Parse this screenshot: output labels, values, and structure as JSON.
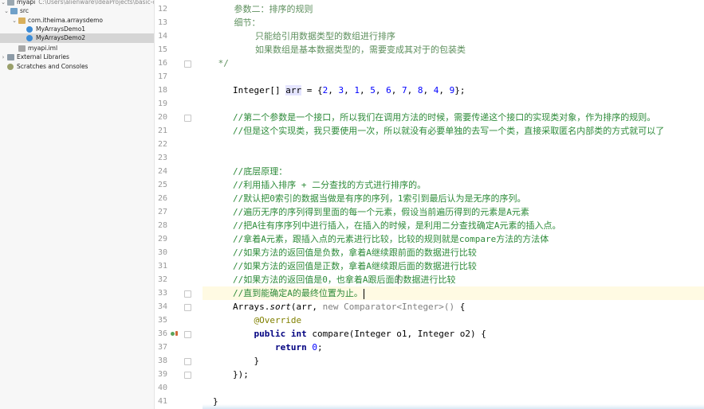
{
  "project_tree": {
    "items": [
      {
        "label": "myapi",
        "path": "C:\\Users\\alienware\\IdeaProjects\\basic-code\\m",
        "arrow": "v",
        "icon": "folder"
      },
      {
        "label": "src",
        "path": "",
        "arrow": "v",
        "icon": "src-folder"
      },
      {
        "label": "com.itheima.arraysdemo",
        "path": "",
        "arrow": "v",
        "icon": "package"
      },
      {
        "label": "MyArraysDemo1",
        "path": "",
        "arrow": "",
        "icon": "class"
      },
      {
        "label": "MyArraysDemo2",
        "path": "",
        "arrow": "",
        "icon": "class"
      },
      {
        "label": "myapi.iml",
        "path": "",
        "arrow": "",
        "icon": "iml-file"
      },
      {
        "label": "External Libraries",
        "path": "",
        "arrow": ">",
        "icon": "library"
      },
      {
        "label": "Scratches and Consoles",
        "path": "",
        "arrow": "",
        "icon": "scratch"
      }
    ],
    "selected": "MyArraysDemo2"
  },
  "editor": {
    "current_line": 33,
    "lines": [
      {
        "n": "12",
        "t": [
          {
            "c": "doc",
            "s": "    参数二：排序的规则"
          }
        ]
      },
      {
        "n": "13",
        "t": [
          {
            "c": "doc",
            "s": "    细节："
          }
        ]
      },
      {
        "n": "14",
        "t": [
          {
            "c": "doc",
            "s": "        只能给引用数据类型的数组进行排序"
          }
        ]
      },
      {
        "n": "15",
        "t": [
          {
            "c": "doc",
            "s": "        如果数组是基本数据类型的，需要变成其对于的包装类"
          }
        ]
      },
      {
        "n": "16",
        "t": [
          {
            "c": "doc",
            "s": " */"
          }
        ]
      },
      {
        "n": "17",
        "t": []
      },
      {
        "n": "18",
        "t": [
          {
            "c": "",
            "s": "Integer[] "
          },
          {
            "c": "hl",
            "s": "arr"
          },
          {
            "c": "",
            "s": " = {"
          },
          {
            "c": "num",
            "s": "2"
          },
          {
            "c": "",
            "s": ", "
          },
          {
            "c": "num",
            "s": "3"
          },
          {
            "c": "",
            "s": ", "
          },
          {
            "c": "num",
            "s": "1"
          },
          {
            "c": "",
            "s": ", "
          },
          {
            "c": "num",
            "s": "5"
          },
          {
            "c": "",
            "s": ", "
          },
          {
            "c": "num",
            "s": "6"
          },
          {
            "c": "",
            "s": ", "
          },
          {
            "c": "num",
            "s": "7"
          },
          {
            "c": "",
            "s": ", "
          },
          {
            "c": "num",
            "s": "8"
          },
          {
            "c": "",
            "s": ", "
          },
          {
            "c": "num",
            "s": "4"
          },
          {
            "c": "",
            "s": ", "
          },
          {
            "c": "num",
            "s": "9"
          },
          {
            "c": "",
            "s": "};"
          }
        ]
      },
      {
        "n": "19",
        "t": []
      },
      {
        "n": "20",
        "t": [
          {
            "c": "cm",
            "s": "//第二个参数是一个接口，所以我们在调用方法的时候，需要传递这个接口的实现类对象，作为排序的规则。"
          }
        ]
      },
      {
        "n": "21",
        "t": [
          {
            "c": "cm",
            "s": "//但是这个实现类，我只要使用一次，所以就没有必要单独的去写一个类，直接采取匿名内部类的方式就可以了"
          }
        ]
      },
      {
        "n": "22",
        "t": []
      },
      {
        "n": "23",
        "t": []
      },
      {
        "n": "24",
        "t": [
          {
            "c": "cm",
            "s": "//底层原理："
          }
        ]
      },
      {
        "n": "25",
        "t": [
          {
            "c": "cm",
            "s": "//利用插入排序 + 二分查找的方式进行排序的。"
          }
        ]
      },
      {
        "n": "26",
        "t": [
          {
            "c": "cm",
            "s": "//默认把0索引的数据当做是有序的序列，1索引到最后认为是无序的序列。"
          }
        ]
      },
      {
        "n": "27",
        "t": [
          {
            "c": "cm",
            "s": "//遍历无序的序列得到里面的每一个元素，假设当前遍历得到的元素是A元素"
          }
        ]
      },
      {
        "n": "28",
        "t": [
          {
            "c": "cm",
            "s": "//把A往有序序列中进行插入，在插入的时候，是利用二分查找确定A元素的插入点。"
          }
        ]
      },
      {
        "n": "29",
        "t": [
          {
            "c": "cm",
            "s": "//拿着A元素，跟插入点的元素进行比较，比较的规则就是compare方法的方法体"
          }
        ]
      },
      {
        "n": "30",
        "t": [
          {
            "c": "cm",
            "s": "//如果方法的返回值是负数，拿着A继续跟前面的数据进行比较"
          }
        ]
      },
      {
        "n": "31",
        "t": [
          {
            "c": "cm",
            "s": "//如果方法的返回值是正数，拿着A继续跟后面的数据进行比较"
          }
        ]
      },
      {
        "n": "32",
        "t": [
          {
            "c": "cm",
            "s": "//如果方法的返回值是0，也拿着A跟后面的数据进行比较"
          }
        ]
      },
      {
        "n": "33",
        "t": [
          {
            "c": "cm",
            "s": "//直到能确定A的最终位置为止。"
          }
        ]
      },
      {
        "n": "34",
        "t": [
          {
            "c": "",
            "s": "Arrays."
          },
          {
            "c": "",
            "s": "sort"
          },
          {
            "c": "",
            "s": "(arr, "
          },
          {
            "c": "param",
            "s": "new Comparator<Integer>()"
          },
          {
            "c": "",
            "s": " {"
          }
        ]
      },
      {
        "n": "35",
        "t": [
          {
            "c": "ann",
            "s": "    @Override"
          }
        ]
      },
      {
        "n": "36",
        "t": [
          {
            "c": "kw",
            "s": "    public int "
          },
          {
            "c": "",
            "s": "compare(Integer o1, Integer o2) {"
          }
        ]
      },
      {
        "n": "37",
        "t": [
          {
            "c": "kw",
            "s": "        return "
          },
          {
            "c": "num",
            "s": "0"
          },
          {
            "c": "",
            "s": ";"
          }
        ]
      },
      {
        "n": "38",
        "t": [
          {
            "c": "",
            "s": "    }"
          }
        ]
      },
      {
        "n": "39",
        "t": [
          {
            "c": "",
            "s": "});"
          }
        ]
      },
      {
        "n": "40",
        "t": []
      },
      {
        "n": "41",
        "t": [
          {
            "c": "",
            "s": "}"
          }
        ]
      }
    ]
  },
  "colors": {
    "comment": "#2e8b3a",
    "keyword": "#000080",
    "number": "#0000ff",
    "annotation": "#808000",
    "current_line_bg": "#fffae3"
  },
  "gutter_icons": {
    "override_marker": "override-icon",
    "fold_marker": "fold-icon"
  }
}
